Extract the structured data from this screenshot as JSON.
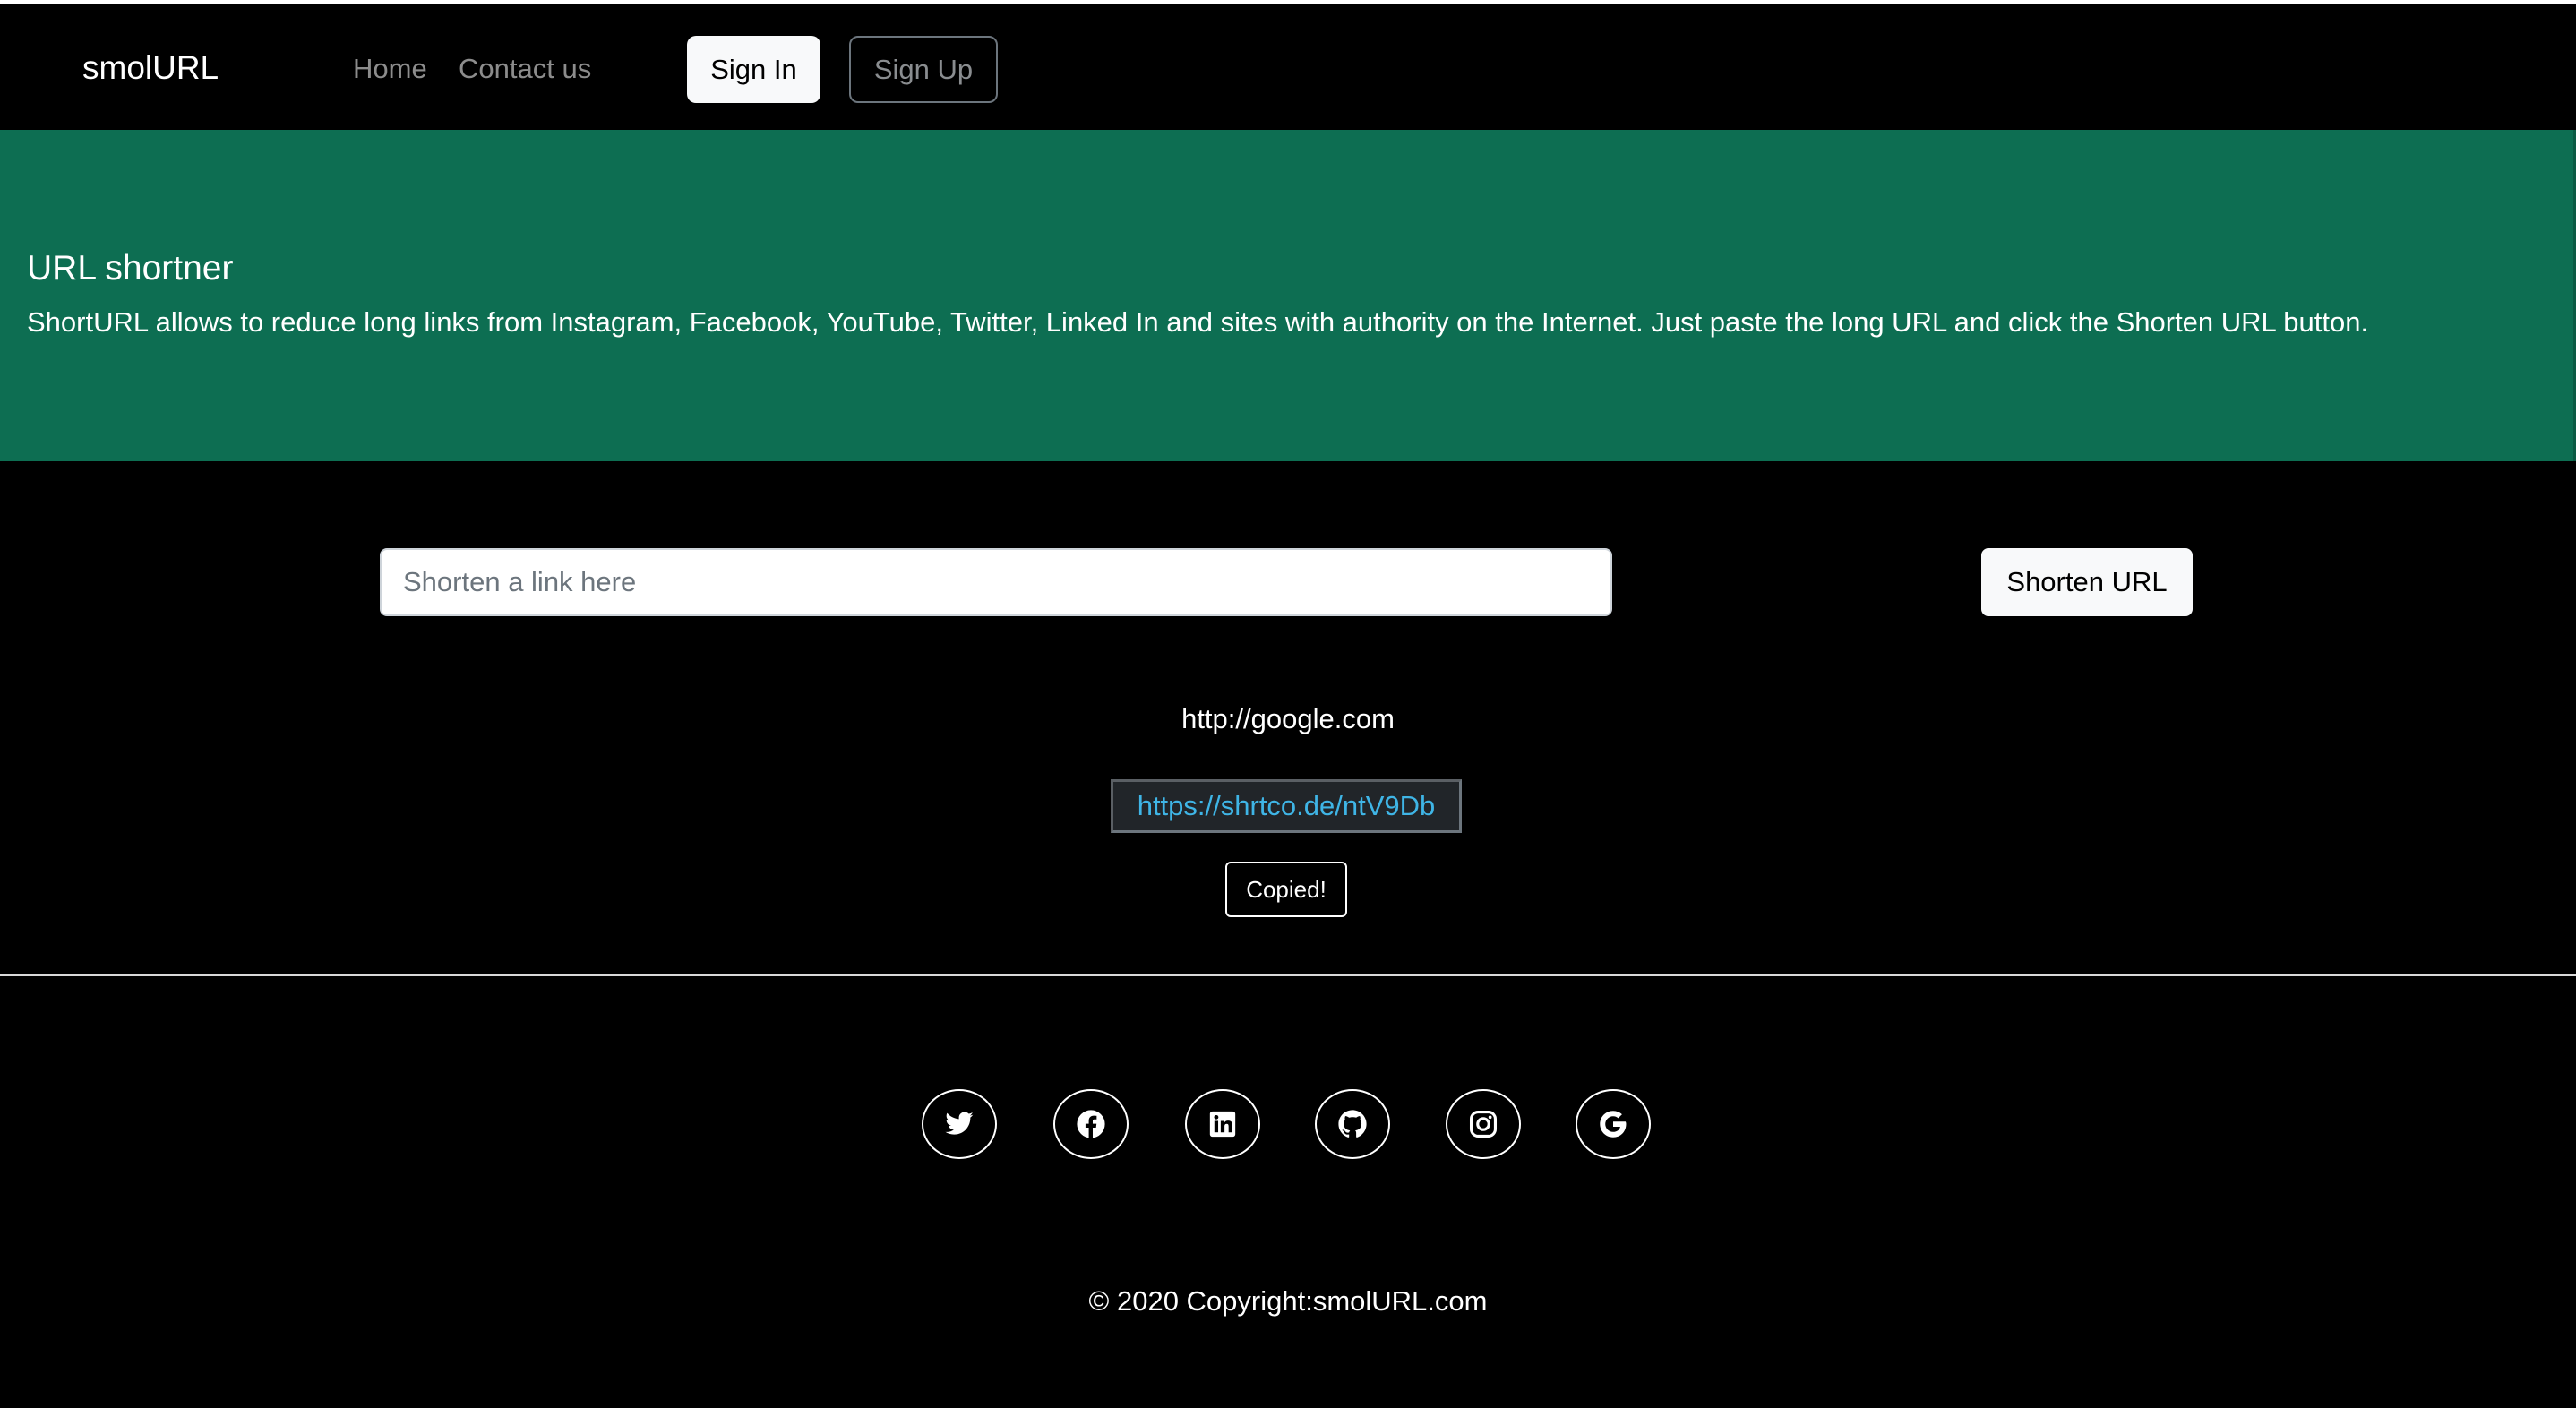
{
  "navbar": {
    "brand": "smolURL",
    "links": [
      {
        "label": "Home"
      },
      {
        "label": "Contact us"
      }
    ],
    "signin_label": "Sign In",
    "signup_label": "Sign Up"
  },
  "hero": {
    "title": "URL shortner",
    "description": "ShortURL allows to reduce long links from Instagram, Facebook, YouTube, Twitter, Linked In and sites with authority on the Internet. Just paste the long URL and click the Shorten URL button.",
    "background_color": "#0d6e52"
  },
  "shorten_form": {
    "input_value": "",
    "input_placeholder": "Shorten a link here",
    "button_label": "Shorten URL"
  },
  "result": {
    "original_url": "http://google.com",
    "short_url": "https://shrtco.de/ntV9Db",
    "copy_button_label": "Copied!",
    "link_color": "#3fb5e6"
  },
  "social_icons": [
    {
      "icon": "twitter-icon"
    },
    {
      "icon": "facebook-icon"
    },
    {
      "icon": "linkedin-icon"
    },
    {
      "icon": "github-icon"
    },
    {
      "icon": "instagram-icon"
    },
    {
      "icon": "google-icon"
    }
  ],
  "footer": {
    "copyright": "© 2020 Copyright:smolURL.com"
  }
}
